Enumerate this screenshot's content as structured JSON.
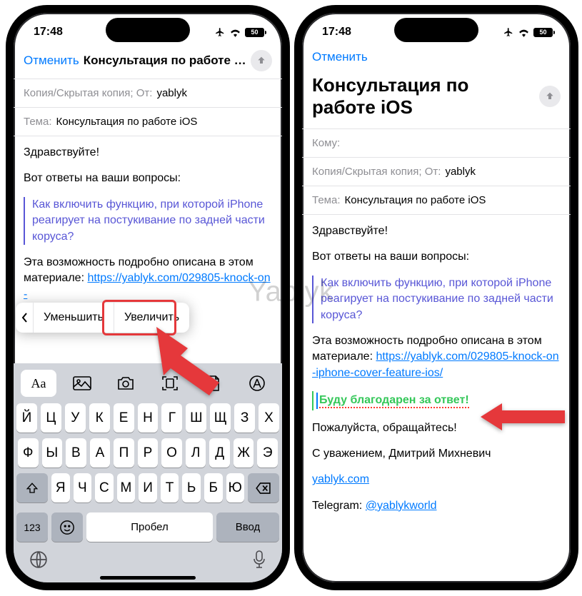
{
  "watermark": "Yablyk",
  "status": {
    "time": "17:48",
    "battery": "50"
  },
  "nav": {
    "cancel": "Отменить",
    "title": "Консультация по работе iOS"
  },
  "fields": {
    "to_label": "Кому:",
    "cc_from_label": "Копия/Скрытая копия; От:",
    "cc_from_value": "yablyk",
    "subject_label": "Тема:",
    "subject_value": "Консультация по работе iOS"
  },
  "body": {
    "greeting": "Здравствуйте!",
    "intro": "Вот ответы на ваши вопросы:",
    "quote": "Как включить функцию, при которой iPhone реагирует на постукивание по задней части коруса?",
    "answer_pre": "Эта возможность подробно описана в этом материале: ",
    "link_short": "https://yablyk.com/029805-knock-on-",
    "link_full": "https://yablyk.com/029805-knock-on-iphone-cover-feature-ios/",
    "inserted": "Буду благодарен за ответ!",
    "closing1": "Пожалуйста, обращайтесь!",
    "sign1": "С уважением, Дмитрий Михневич",
    "sign2": "yablyk.com",
    "sign3": "Telegram: ",
    "sign3_link": "@yablykworld"
  },
  "popover": {
    "decrease": "Уменьшить",
    "increase": "Увеличить"
  },
  "keyboard": {
    "row1": [
      "й",
      "ц",
      "у",
      "к",
      "е",
      "н",
      "г",
      "ш",
      "щ",
      "з",
      "х"
    ],
    "row2": [
      "ф",
      "ы",
      "в",
      "а",
      "п",
      "р",
      "о",
      "л",
      "д",
      "ж",
      "э"
    ],
    "row3": [
      "я",
      "ч",
      "с",
      "м",
      "и",
      "т",
      "ь",
      "б",
      "ю"
    ],
    "numbers": "123",
    "space": "Пробел",
    "enter": "Ввод"
  }
}
